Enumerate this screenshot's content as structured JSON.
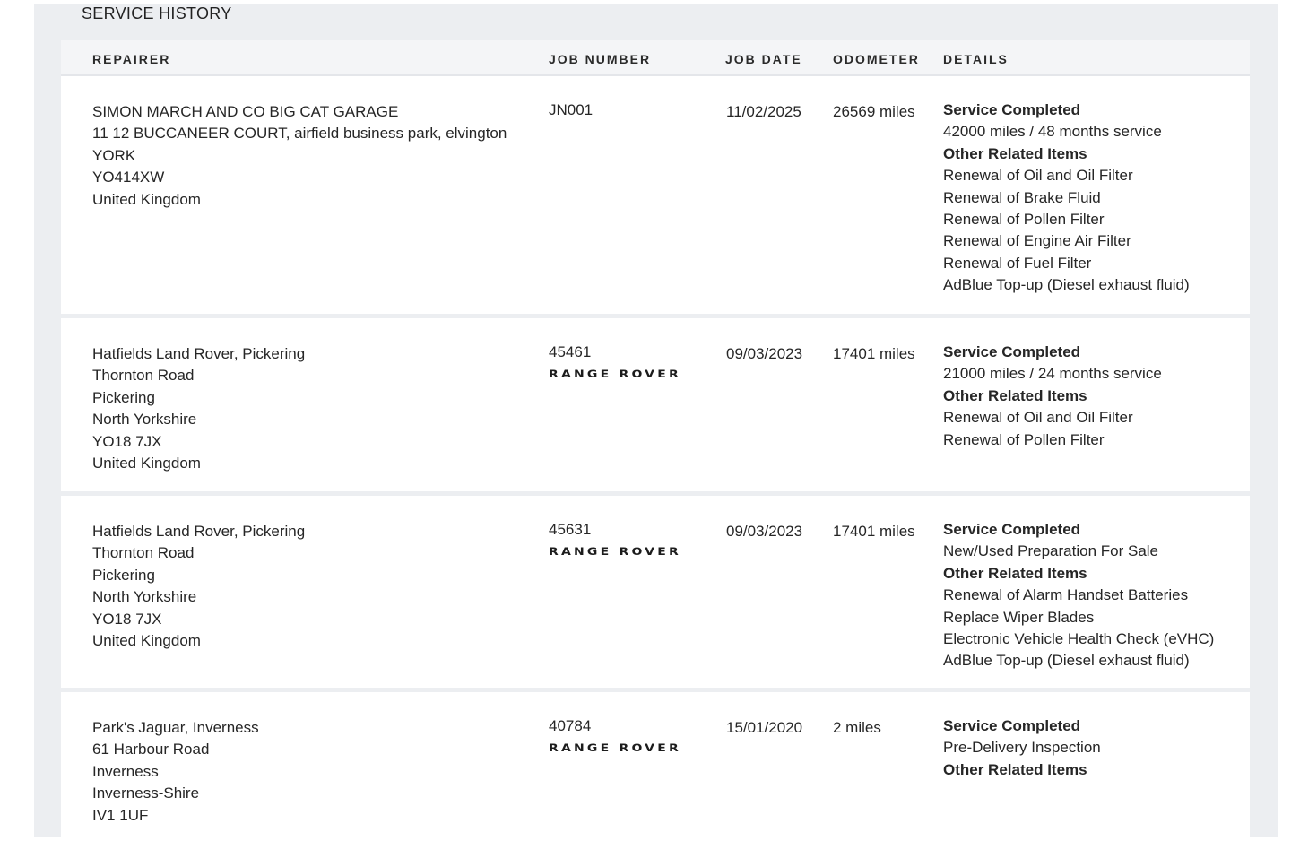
{
  "section": {
    "title": "SERVICE HISTORY"
  },
  "columns": {
    "repairer": "REPAIRER",
    "job_number": "JOB NUMBER",
    "job_date": "JOB DATE",
    "odometer": "ODOMETER",
    "details": "DETAILS"
  },
  "rows": [
    {
      "repairer": [
        "SIMON MARCH AND CO BIG CAT GARAGE",
        "11 12 BUCCANEER COURT, airfield business park, elvington",
        "YORK",
        "YO414XW",
        "United Kingdom"
      ],
      "job_number": "JN001",
      "logo": "",
      "job_date": "11/02/2025",
      "odometer": "26569 miles",
      "service_heading": "Service Completed",
      "service": "42000 miles / 48 months service",
      "other_heading": "Other Related Items",
      "items": [
        "Renewal of Oil and Oil Filter",
        "Renewal of Brake Fluid",
        "Renewal of Pollen Filter",
        "Renewal of Engine Air Filter",
        "Renewal of Fuel Filter",
        "AdBlue Top-up (Diesel exhaust fluid)"
      ]
    },
    {
      "repairer": [
        "Hatfields Land Rover, Pickering",
        "Thornton Road",
        "Pickering",
        "North Yorkshire",
        "YO18 7JX",
        "United Kingdom"
      ],
      "job_number": "45461",
      "logo": "RANGE ROVER",
      "job_date": "09/03/2023",
      "odometer": "17401 miles",
      "service_heading": "Service Completed",
      "service": "21000 miles / 24 months service",
      "other_heading": "Other Related Items",
      "items": [
        "Renewal of Oil and Oil Filter",
        "Renewal of Pollen Filter"
      ]
    },
    {
      "repairer": [
        "Hatfields Land Rover, Pickering",
        "Thornton Road",
        "Pickering",
        "North Yorkshire",
        "YO18 7JX",
        "United Kingdom"
      ],
      "job_number": "45631",
      "logo": "RANGE ROVER",
      "job_date": "09/03/2023",
      "odometer": "17401 miles",
      "service_heading": "Service Completed",
      "service": "New/Used Preparation For Sale",
      "other_heading": "Other Related Items",
      "items": [
        "Renewal of Alarm Handset Batteries",
        "Replace Wiper Blades",
        "Electronic Vehicle Health Check (eVHC)",
        "AdBlue Top-up (Diesel exhaust fluid)"
      ]
    },
    {
      "repairer": [
        "Park's Jaguar, Inverness",
        "61 Harbour Road",
        "Inverness",
        "Inverness-Shire",
        "IV1 1UF"
      ],
      "job_number": "40784",
      "logo": "RANGE ROVER",
      "job_date": "15/01/2020",
      "odometer": "2 miles",
      "service_heading": "Service Completed",
      "service": "Pre-Delivery Inspection",
      "other_heading": "Other Related Items",
      "items": []
    }
  ]
}
